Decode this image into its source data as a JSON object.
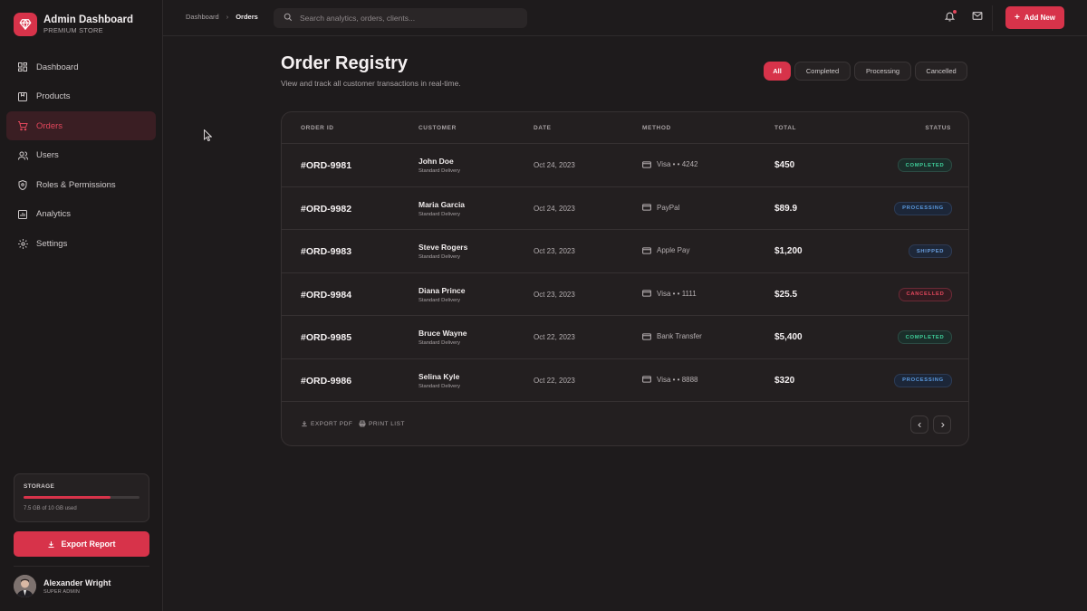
{
  "brand": {
    "title": "Admin Dashboard",
    "subtitle": "PREMIUM STORE"
  },
  "colors": {
    "accent": "#d7334a",
    "background": "#1e1b1c",
    "completed": "#3fcf9a",
    "processing": "#4d8fd6",
    "shipped": "#6a9fe0",
    "cancelled": "#e2475c"
  },
  "sidebar": {
    "items": [
      {
        "label": "Dashboard",
        "icon": "grid-icon"
      },
      {
        "label": "Products",
        "icon": "box-icon"
      },
      {
        "label": "Orders",
        "icon": "cart-icon",
        "active": true
      },
      {
        "label": "Users",
        "icon": "users-icon"
      },
      {
        "label": "Roles & Permissions",
        "icon": "shield-icon"
      },
      {
        "label": "Analytics",
        "icon": "chart-icon"
      },
      {
        "label": "Settings",
        "icon": "gear-icon"
      }
    ],
    "storage": {
      "label": "STORAGE",
      "text": "7.5 GB of 10 GB used",
      "used_fraction": 0.75
    },
    "export_label": "Export Report",
    "user": {
      "name": "Alexander Wright",
      "role": "SUPER ADMIN"
    }
  },
  "topbar": {
    "breadcrumb": [
      "Dashboard",
      "Orders"
    ],
    "search_placeholder": "Search analytics, orders, clients...",
    "add_new_label": "Add New"
  },
  "main": {
    "title": "Order Registry",
    "subtitle": "View and track all customer transactions in real-time.",
    "filters": [
      "All",
      "Completed",
      "Processing",
      "Cancelled"
    ],
    "active_filter": "All"
  },
  "table": {
    "headers": [
      "ORDER ID",
      "CUSTOMER",
      "DATE",
      "METHOD",
      "TOTAL",
      "STATUS"
    ],
    "rows": [
      {
        "id": "#ORD-9981",
        "customer": "John Doe",
        "delivery": "Standard Delivery",
        "date": "Oct 24, 2023",
        "method": "Visa • • 4242",
        "total": "$450",
        "status": "COMPLETED"
      },
      {
        "id": "#ORD-9982",
        "customer": "Maria Garcia",
        "delivery": "Standard Delivery",
        "date": "Oct 24, 2023",
        "method": "PayPal",
        "total": "$89.9",
        "status": "PROCESSING"
      },
      {
        "id": "#ORD-9983",
        "customer": "Steve Rogers",
        "delivery": "Standard Delivery",
        "date": "Oct 23, 2023",
        "method": "Apple Pay",
        "total": "$1,200",
        "status": "SHIPPED"
      },
      {
        "id": "#ORD-9984",
        "customer": "Diana Prince",
        "delivery": "Standard Delivery",
        "date": "Oct 23, 2023",
        "method": "Visa • • 1111",
        "total": "$25.5",
        "status": "CANCELLED"
      },
      {
        "id": "#ORD-9985",
        "customer": "Bruce Wayne",
        "delivery": "Standard Delivery",
        "date": "Oct 22, 2023",
        "method": "Bank Transfer",
        "total": "$5,400",
        "status": "COMPLETED"
      },
      {
        "id": "#ORD-9986",
        "customer": "Selina Kyle",
        "delivery": "Standard Delivery",
        "date": "Oct 22, 2023",
        "method": "Visa • • 8888",
        "total": "$320",
        "status": "PROCESSING"
      }
    ],
    "footer": {
      "export_pdf": "EXPORT PDF",
      "print_list": "PRINT LIST"
    }
  }
}
